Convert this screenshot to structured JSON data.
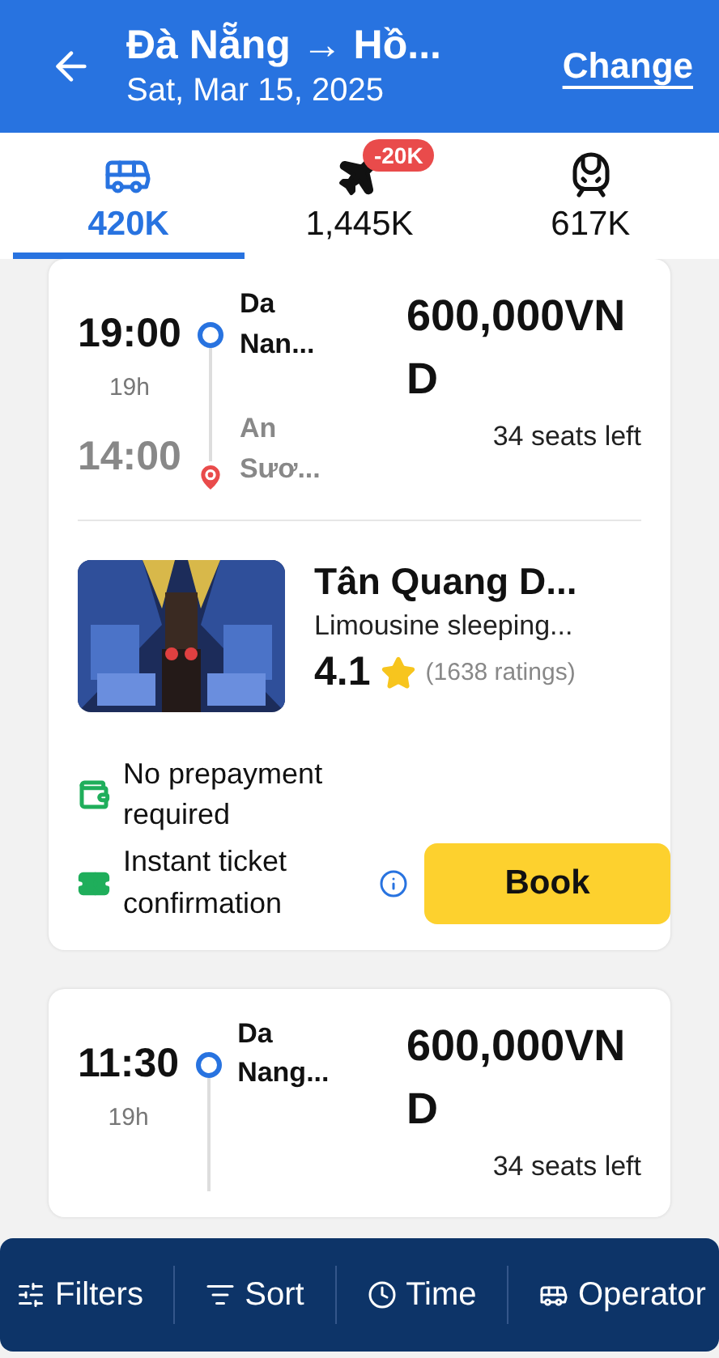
{
  "header": {
    "title": "Đà Nẵng → Hồ...",
    "date": "Sat, Mar 15, 2025",
    "action": "Change"
  },
  "tabs": [
    {
      "kind": "bus",
      "label": "420K",
      "selected": true
    },
    {
      "kind": "plane",
      "label": "1,445K",
      "badge": "-20K",
      "selected": false
    },
    {
      "kind": "train",
      "label": "617K",
      "selected": false
    }
  ],
  "trips": [
    {
      "depart": "19:00",
      "duration": "19h",
      "arrive": "14:00",
      "from": "Da Nan...",
      "to": "An Sươ...",
      "price": "600,000VND",
      "seats": "34 seats left",
      "operator": {
        "kind": "picture",
        "name": "Tân Quang D...",
        "type": "Limousine sleeping...",
        "rating": "4.1",
        "ratings": "(1638 ratings)"
      },
      "perks": [
        {
          "kind": "wallet",
          "text": "No prepayment required"
        },
        {
          "kind": "ticket",
          "text": "Instant ticket confirmation",
          "info": true
        }
      ],
      "book": "Book"
    },
    {
      "depart": "11:30",
      "duration": "19h",
      "from": "Da Nang...",
      "price": "600,000VND",
      "seats": "34 seats left"
    }
  ],
  "toolbar": [
    {
      "kind": "filters",
      "label": "Filters"
    },
    {
      "kind": "sort",
      "label": "Sort"
    },
    {
      "kind": "time",
      "label": "Time"
    },
    {
      "kind": "operator",
      "label": "Operator"
    }
  ]
}
